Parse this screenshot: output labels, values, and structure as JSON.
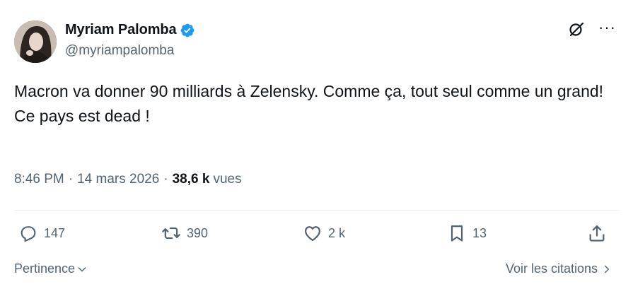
{
  "author": {
    "display_name": "Myriam Palomba",
    "handle": "@myriampalomba",
    "verified": true
  },
  "tweet": {
    "text": "Macron va donner 90 milliards à Zelensky. Comme ça, tout seul comme un grand!\nCe pays est dead !",
    "time": "8:46 PM",
    "date": "14 mars 2026",
    "views_count": "38,6 k",
    "views_label": "vues"
  },
  "actions": {
    "replies": "147",
    "retweets": "390",
    "likes": "2 k",
    "bookmarks": "13"
  },
  "footer": {
    "sort_label": "Pertinence",
    "quotes_label": "Voir les citations"
  },
  "colors": {
    "text": "#0f1419",
    "secondary": "#536471",
    "verified": "#1d9bf0",
    "divider": "#eff3f4"
  },
  "icons": [
    "verified-badge-icon",
    "grok-icon",
    "more-icon",
    "reply-icon",
    "retweet-icon",
    "like-icon",
    "bookmark-icon",
    "share-icon",
    "chevron-down-icon",
    "chevron-right-icon"
  ]
}
